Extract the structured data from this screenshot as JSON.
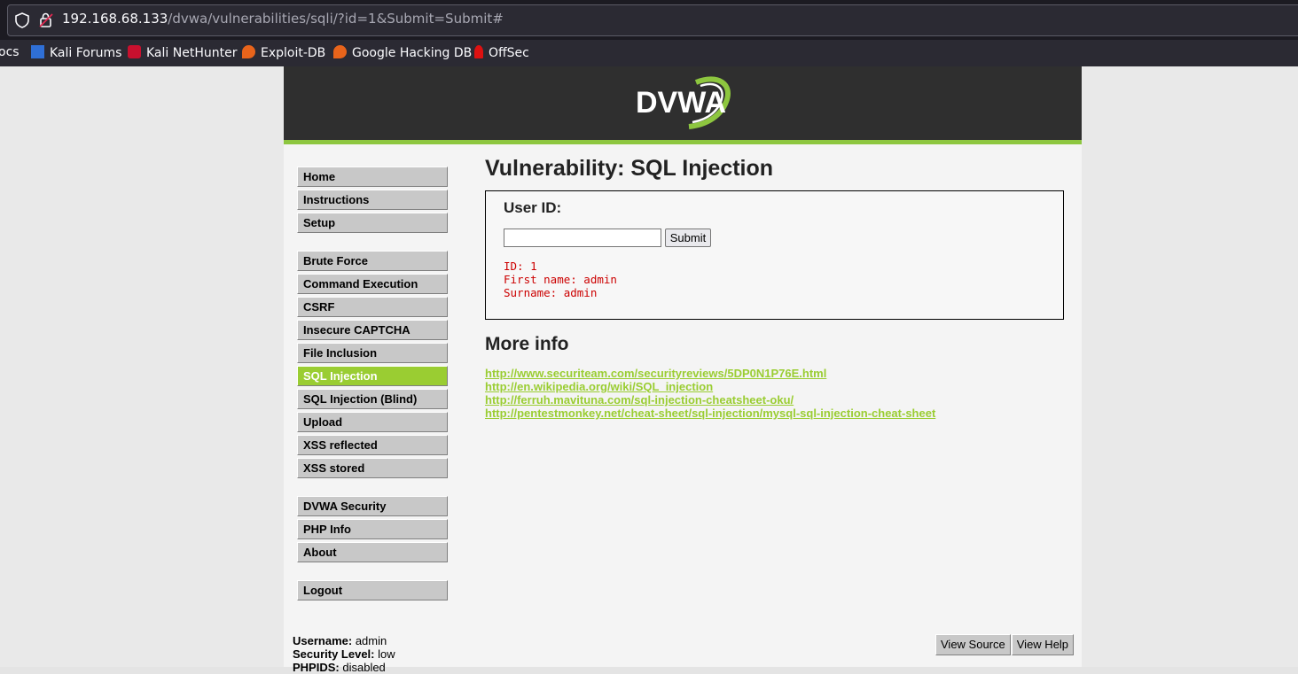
{
  "browser": {
    "url_host": "192.168.68.133",
    "url_path": "/dvwa/vulnerabilities/sqli/?id=1&Submit=Submit#",
    "bookmarks": [
      "ocs",
      "Kali Forums",
      "Kali NetHunter",
      "Exploit-DB",
      "Google Hacking DB",
      "OffSec"
    ]
  },
  "logo_text": "DVWA",
  "menu": {
    "home": "Home",
    "instructions": "Instructions",
    "setup": "Setup",
    "brute": "Brute Force",
    "cmd": "Command Execution",
    "csrf": "CSRF",
    "captcha": "Insecure CAPTCHA",
    "fi": "File Inclusion",
    "sqli": "SQL Injection",
    "sqli_blind": "SQL Injection (Blind)",
    "upload": "Upload",
    "xss_r": "XSS reflected",
    "xss_s": "XSS stored",
    "security": "DVWA Security",
    "phpinfo": "PHP Info",
    "about": "About",
    "logout": "Logout"
  },
  "main": {
    "title": "Vulnerability: SQL Injection",
    "user_id_label": "User ID:",
    "input_value": "",
    "submit_label": "Submit",
    "result": [
      "ID: 1",
      "First name: admin",
      "Surname: admin"
    ],
    "more_info_title": "More info",
    "links": [
      "http://www.securiteam.com/securityreviews/5DP0N1P76E.html",
      "http://en.wikipedia.org/wiki/SQL_injection",
      "http://ferruh.mavituna.com/sql-injection-cheatsheet-oku/",
      "http://pentestmonkey.net/cheat-sheet/sql-injection/mysql-sql-injection-cheat-sheet"
    ]
  },
  "footer": {
    "username_label": "Username:",
    "username": "admin",
    "security_label": "Security Level:",
    "security": "low",
    "phpids_label": "PHPIDS:",
    "phpids": "disabled",
    "view_source": "View Source",
    "view_help": "View Help"
  },
  "colors": {
    "accent": "#9acd32",
    "header": "#2f2f2f",
    "result": "#cc0000"
  }
}
